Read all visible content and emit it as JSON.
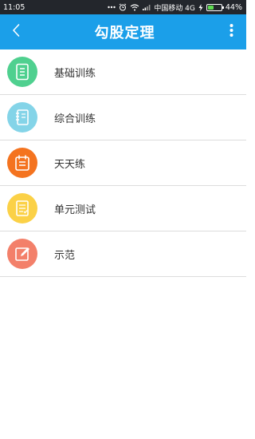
{
  "status_bar": {
    "time": "11:05",
    "carrier": "中国移动 4G",
    "battery": "44%",
    "battery_level": 0.44,
    "icons": [
      "dots-icon",
      "alarm-icon",
      "wifi-icon",
      "signal-icon",
      "charging-icon",
      "battery-icon"
    ]
  },
  "app_bar": {
    "title": "勾股定理",
    "back_icon": "chevron-left-icon",
    "more_icon": "more-vertical-icon"
  },
  "menu": {
    "items": [
      {
        "label": "基础训练",
        "icon": "document-icon",
        "color": "#4fd08f"
      },
      {
        "label": "综合训练",
        "icon": "notebook-icon",
        "color": "#84d4e8"
      },
      {
        "label": "天天练",
        "icon": "calendar-icon",
        "color": "#f4731f"
      },
      {
        "label": "单元测试",
        "icon": "checklist-icon",
        "color": "#fbd147"
      },
      {
        "label": "示范",
        "icon": "edit-icon",
        "color": "#f3806a"
      }
    ]
  }
}
